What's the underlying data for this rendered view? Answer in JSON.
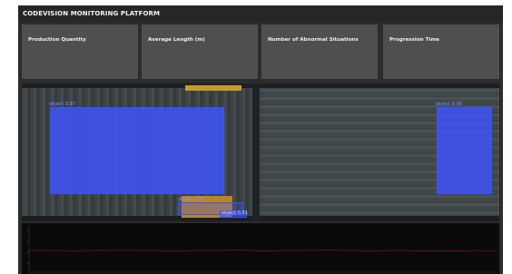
{
  "app": {
    "title": "CODEVISION MONITORING PLATFORM"
  },
  "kpis": [
    {
      "label": "Production Quantity"
    },
    {
      "label": "Average Length (m)"
    },
    {
      "label": "Number of Abnormal Situations"
    },
    {
      "label": "Progression Time"
    }
  ],
  "video_feed": {
    "detections": [
      {
        "label": "object",
        "confidence": "0.87",
        "caption": "object 0.87"
      },
      {
        "label": "object",
        "confidence": "0.90",
        "caption": "object 0.90"
      },
      {
        "label": "object",
        "confidence": "0.81",
        "caption": "object 0.81"
      },
      {
        "label": "object",
        "confidence": "0.51",
        "caption": "object 0.51"
      }
    ]
  },
  "colors": {
    "background": "#2c2c2c",
    "card": "#4f4f4f",
    "detection": "#3e54ff",
    "chart_bg": "#0a0a0a",
    "chart_line": "#7a1a1a"
  }
}
